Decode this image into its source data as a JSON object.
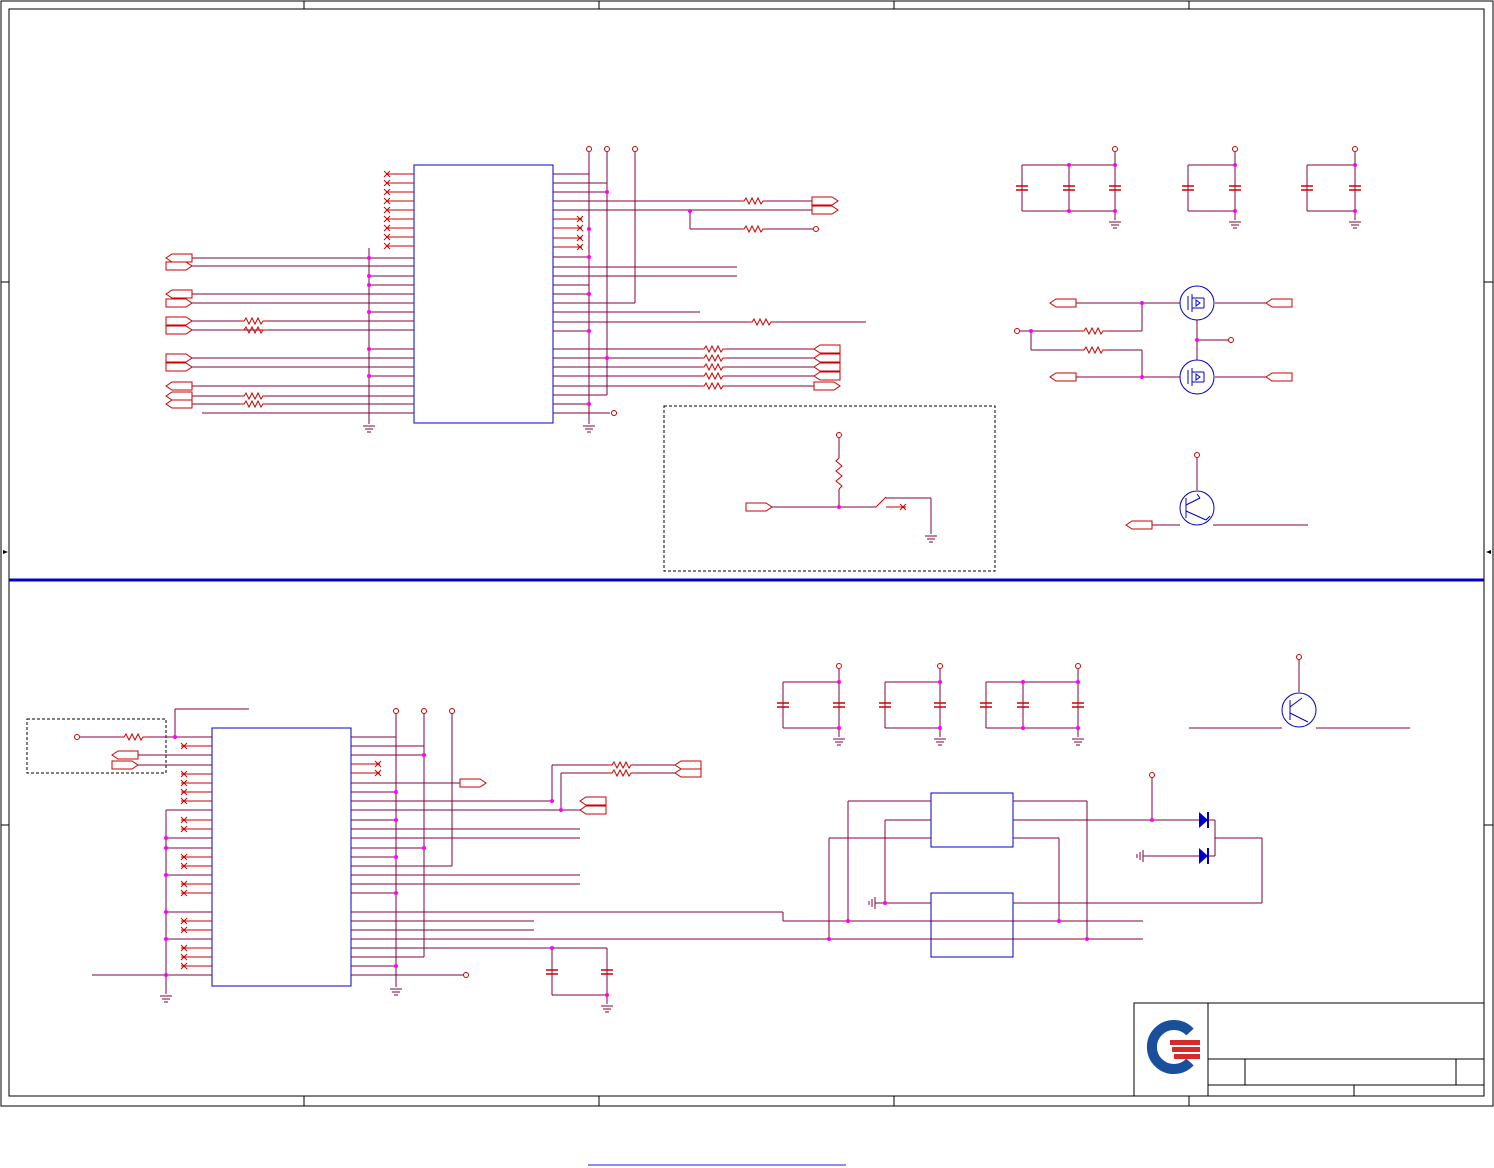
{
  "document": {
    "kind": "schematic-sheet",
    "colors": {
      "frame": "#000000",
      "net": "#800040",
      "component": "#cc0000",
      "junction": "#ff00ff",
      "semiconductor": "#0000cc",
      "divider": "#0000cc",
      "logo_blue": "#1a4f9c",
      "logo_red": "#d52b2b"
    },
    "icons": [
      "resistor-icon",
      "capacitor-icon",
      "ground-icon",
      "mosfet-icon",
      "transistor-icon",
      "diode-icon",
      "company-logo"
    ],
    "footer_link": ""
  }
}
